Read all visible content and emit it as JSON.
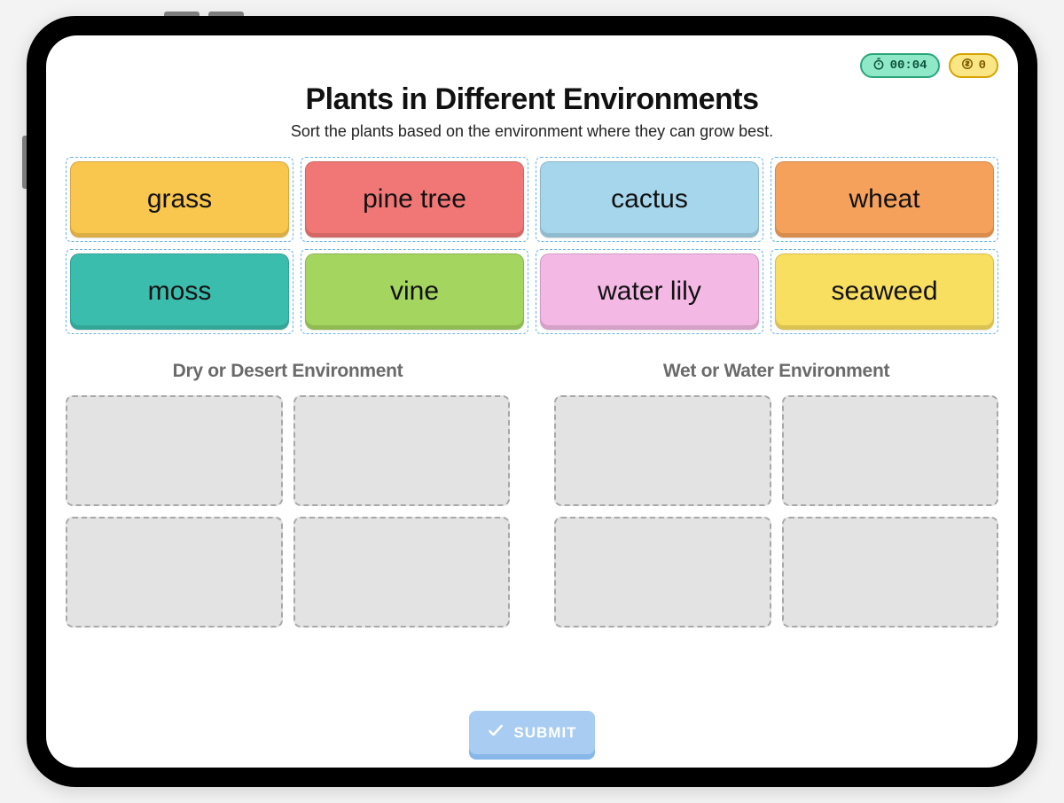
{
  "status": {
    "timer": "00:04",
    "coins": "0"
  },
  "header": {
    "title": "Plants in Different Environments",
    "subtitle": "Sort the plants based on the environment where they can grow best."
  },
  "plants": [
    {
      "label": "grass",
      "color": "#f9c64e"
    },
    {
      "label": "pine tree",
      "color": "#f17776"
    },
    {
      "label": "cactus",
      "color": "#a5d6ec"
    },
    {
      "label": "wheat",
      "color": "#f6a15b"
    },
    {
      "label": "moss",
      "color": "#3bbdae"
    },
    {
      "label": "vine",
      "color": "#a4d55f"
    },
    {
      "label": "water lily",
      "color": "#f3b8e4"
    },
    {
      "label": "seaweed",
      "color": "#f9df5f"
    }
  ],
  "drop_groups": [
    {
      "title": "Dry or Desert Environment",
      "slots": 4
    },
    {
      "title": "Wet or Water Environment",
      "slots": 4
    }
  ],
  "footer": {
    "submit_label": "SUBMIT"
  }
}
